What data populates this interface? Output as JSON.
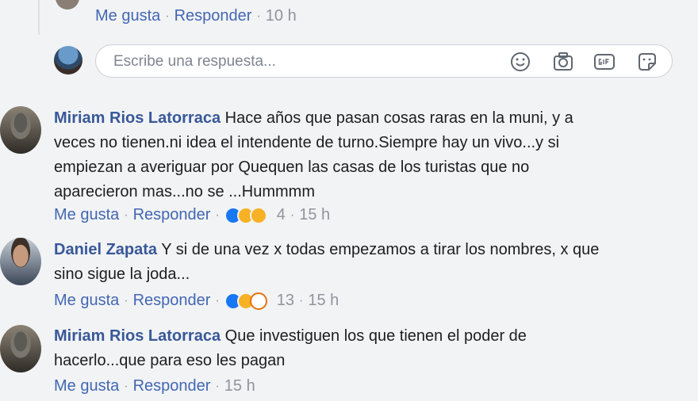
{
  "thread": {
    "action_row": {
      "like": "Me gusta",
      "reply": "Responder",
      "time": "10 h"
    }
  },
  "reply_box": {
    "placeholder": "Escribe una respuesta...",
    "icons": [
      "emoji-icon",
      "camera-icon",
      "gif-icon",
      "sticker-icon"
    ]
  },
  "comments": [
    {
      "author": "Miriam Rios Latorraca",
      "lines": [
        "Hace años que pasan cosas raras en la muni, y a",
        "veces no tienen.ni idea el intendente de turno.Siempre hay un vivo...y si",
        "empiezan a averiguar por Quequen las casas de los turistas que no",
        "aparecieron mas...no se ...Hummmm"
      ],
      "like": "Me gusta",
      "reply": "Responder",
      "reactions": [
        "like",
        "wow",
        "sad"
      ],
      "reaction_count": "4",
      "time": "15 h"
    },
    {
      "author": "Daniel Zapata",
      "lines": [
        "Y si de una vez x todas empezamos a tirar los nombres, x que",
        "sino sigue la joda..."
      ],
      "like": "Me gusta",
      "reply": "Responder",
      "reactions": [
        "like",
        "haha",
        "angry"
      ],
      "reaction_count": "13",
      "time": "15 h"
    },
    {
      "author": "Miriam Rios Latorraca",
      "lines": [
        "Que investiguen los que tienen el poder de",
        "hacerlo...que para eso les pagan"
      ],
      "like": "Me gusta",
      "reply": "Responder",
      "time": "15 h"
    }
  ],
  "colors": {
    "link": "#4267b2",
    "author": "#385898",
    "muted": "#90949c",
    "background": "#f2f3f5"
  }
}
